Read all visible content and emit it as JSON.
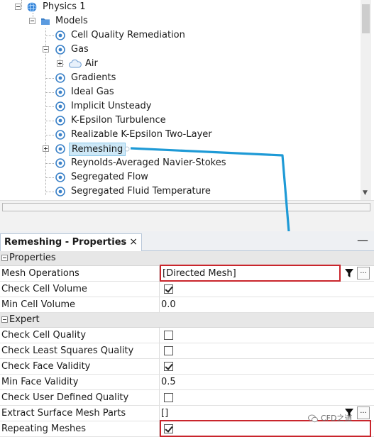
{
  "tree": {
    "physics_label": "Physics 1",
    "models_label": "Models",
    "items": [
      {
        "label": "Cell Quality Remediation"
      },
      {
        "label": "Gas"
      },
      {
        "label": "Air"
      },
      {
        "label": "Gradients"
      },
      {
        "label": "Ideal Gas"
      },
      {
        "label": "Implicit Unsteady"
      },
      {
        "label": "K-Epsilon Turbulence"
      },
      {
        "label": "Realizable K-Epsilon Two-Layer"
      },
      {
        "label": "Remeshing"
      },
      {
        "label": "Reynolds-Averaged Navier-Stokes"
      },
      {
        "label": "Segregated Flow"
      },
      {
        "label": "Segregated Fluid Temperature"
      }
    ]
  },
  "properties": {
    "tab_title": "Remeshing - Properties",
    "close_glyph": "×",
    "minimize_glyph": "—",
    "groups": {
      "properties": "Properties",
      "expert": "Expert"
    },
    "rows": {
      "mesh_operations": {
        "name": "Mesh Operations",
        "value": "[Directed Mesh]"
      },
      "check_cell_volume": {
        "name": "Check Cell Volume",
        "checked": true
      },
      "min_cell_volume": {
        "name": "Min Cell Volume",
        "value": "0.0"
      },
      "check_cell_quality": {
        "name": "Check Cell Quality",
        "checked": false
      },
      "check_least_squares_quality": {
        "name": "Check Least Squares Quality",
        "checked": false
      },
      "check_face_validity": {
        "name": "Check Face Validity",
        "checked": true
      },
      "min_face_validity": {
        "name": "Min Face Validity",
        "value": "0.5"
      },
      "check_user_defined_quality": {
        "name": "Check User Defined Quality",
        "checked": false
      },
      "extract_surface_mesh_parts": {
        "name": "Extract Surface Mesh Parts",
        "value": "[]"
      },
      "repeating_meshes": {
        "name": "Repeating Meshes",
        "checked": true
      }
    },
    "ellipsis_label": "..."
  },
  "watermark": {
    "text": "CFD之道"
  },
  "colors": {
    "highlight_red": "#c9252c",
    "arrow_blue": "#1e9ad6",
    "selection_bg": "#cde8f7"
  }
}
